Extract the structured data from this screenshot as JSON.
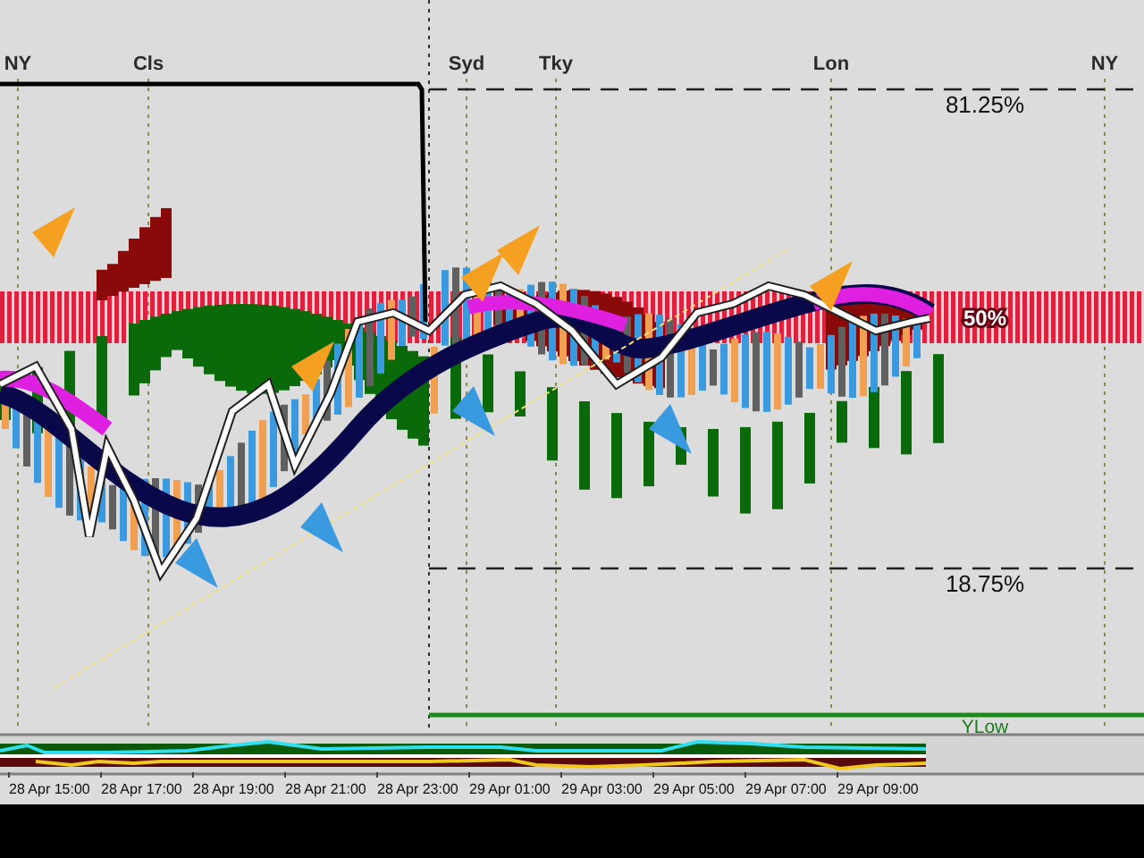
{
  "sessions": [
    {
      "label": "NY"
    },
    {
      "label": "Cls"
    },
    {
      "label": "Syd"
    },
    {
      "label": "Tky"
    },
    {
      "label": "Lon"
    },
    {
      "label": "NY"
    }
  ],
  "levels": [
    {
      "label": "81.25%",
      "kind": "dashed"
    },
    {
      "label": "50%",
      "kind": "zone"
    },
    {
      "label": "18.75%",
      "kind": "dashed"
    },
    {
      "label": "YLow",
      "kind": "low"
    }
  ],
  "time_axis": [
    "28 Apr 15:00",
    "28 Apr 17:00",
    "28 Apr 19:00",
    "28 Apr 21:00",
    "28 Apr 23:00",
    "29 Apr 01:00",
    "29 Apr 03:00",
    "29 Apr 05:00",
    "29 Apr 07:00",
    "29 Apr 09:00"
  ]
}
